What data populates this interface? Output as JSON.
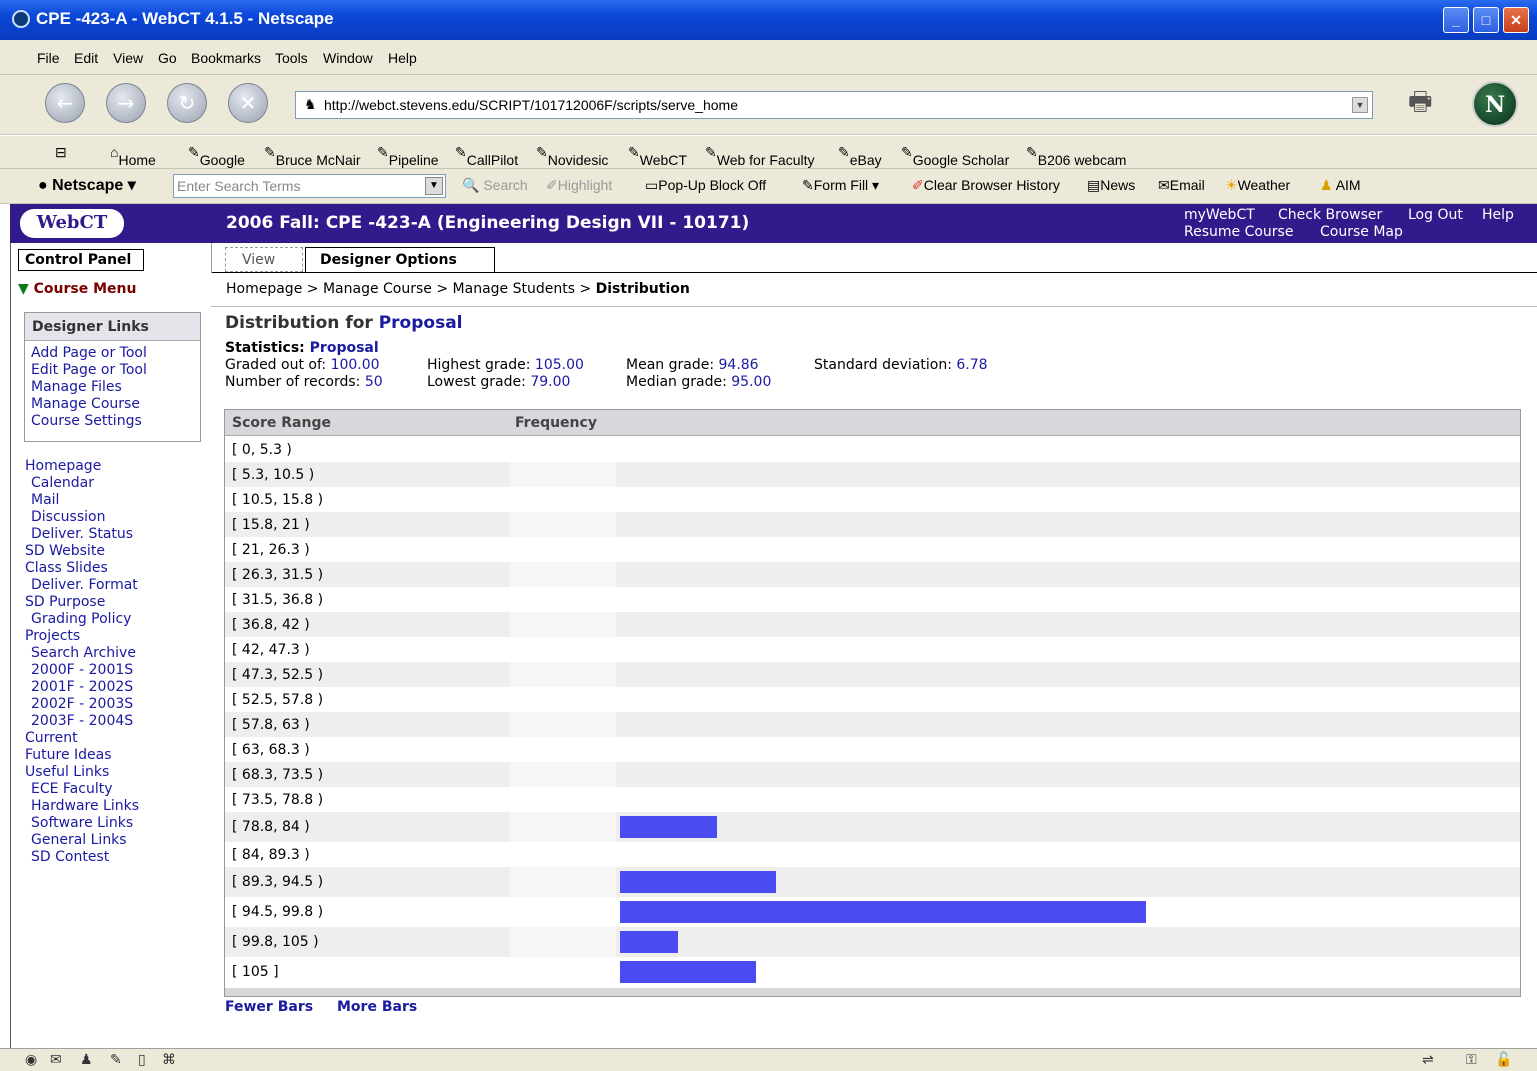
{
  "window": {
    "title": "CPE -423-A - WebCT 4.1.5 - Netscape"
  },
  "menu": [
    "File",
    "Edit",
    "View",
    "Go",
    "Bookmarks",
    "Tools",
    "Window",
    "Help"
  ],
  "address": {
    "url": "http://webct.stevens.edu/SCRIPT/101712006F/scripts/serve_home"
  },
  "bookmarks": [
    "Home",
    "Google",
    "Bruce McNair",
    "Pipeline",
    "CallPilot",
    "Novidesic",
    "WebCT",
    "Web for Faculty",
    "eBay",
    "Google Scholar",
    "B206 webcam"
  ],
  "toolbar": {
    "brand": "Netscape ▾",
    "search_placeholder": "Enter Search Terms",
    "search": "Search",
    "highlight": "Highlight",
    "popup": "Pop-Up Block Off",
    "formfill": "Form Fill ▾",
    "clear_history": "Clear Browser History",
    "news": "News",
    "email": "Email",
    "weather": "Weather",
    "aim": "AIM"
  },
  "webct": {
    "logo": "WebCT",
    "course_title": "2006 Fall: CPE -423-A  (Engineering Design VII - 10171)",
    "links": {
      "my_webct": "myWebCT",
      "check_browser": "Check Browser",
      "log_out": "Log Out",
      "help": "Help",
      "resume_course": "Resume Course",
      "course_map": "Course Map"
    }
  },
  "left": {
    "control_panel": "Control Panel",
    "course_menu": "Course Menu",
    "designer_links_title": "Designer Links",
    "designer_links": [
      "Add Page or Tool",
      "Edit Page or Tool",
      "Manage Files",
      "Manage Course",
      "Course Settings"
    ],
    "course_nav": [
      {
        "label": "Homepage",
        "indent": false
      },
      {
        "label": "Calendar",
        "indent": true
      },
      {
        "label": "Mail",
        "indent": true
      },
      {
        "label": "Discussion",
        "indent": true
      },
      {
        "label": "Deliver. Status",
        "indent": true
      },
      {
        "label": "SD Website",
        "indent": false
      },
      {
        "label": "Class Slides",
        "indent": false
      },
      {
        "label": "Deliver. Format",
        "indent": true
      },
      {
        "label": "SD Purpose",
        "indent": false
      },
      {
        "label": "Grading Policy",
        "indent": true
      },
      {
        "label": "Projects",
        "indent": false
      },
      {
        "label": "Search Archive",
        "indent": true
      },
      {
        "label": "2000F - 2001S",
        "indent": true
      },
      {
        "label": "2001F - 2002S",
        "indent": true
      },
      {
        "label": "2002F - 2003S",
        "indent": true
      },
      {
        "label": "2003F - 2004S",
        "indent": true
      },
      {
        "label": "Current",
        "indent": false
      },
      {
        "label": "Future Ideas",
        "indent": false
      },
      {
        "label": "Useful Links",
        "indent": false
      },
      {
        "label": "ECE Faculty",
        "indent": true
      },
      {
        "label": "Hardware Links",
        "indent": true
      },
      {
        "label": "Software Links",
        "indent": true
      },
      {
        "label": "General Links",
        "indent": true
      },
      {
        "label": "SD Contest",
        "indent": true
      }
    ]
  },
  "tabs": {
    "view": "View",
    "designer_options": "Designer Options"
  },
  "breadcrumb": {
    "items": [
      "Homepage",
      "Manage Course",
      "Manage Students"
    ],
    "current": "Distribution",
    "sep": ">"
  },
  "distribution": {
    "title_prefix": "Distribution for",
    "title_name": "Proposal",
    "stats_label": "Statistics:",
    "stats_name": "Proposal",
    "graded_out_of_label": "Graded out of:",
    "graded_out_of": "100.00",
    "num_records_label": "Number of records:",
    "num_records": "50",
    "highest_label": "Highest grade:",
    "highest": "105.00",
    "lowest_label": "Lowest grade:",
    "lowest": "79.00",
    "mean_label": "Mean grade:",
    "mean": "94.86",
    "median_label": "Median grade:",
    "median": "95.00",
    "std_label": "Standard deviation:",
    "std": "6.78",
    "col_score": "Score Range",
    "col_freq": "Frequency",
    "fewer_bars": "Fewer Bars",
    "more_bars": "More Bars",
    "bar_color": "#4b4bf2"
  },
  "chart_data": {
    "type": "bar",
    "orientation": "horizontal",
    "xlabel": "Frequency",
    "ylabel": "Score Range",
    "categories": [
      "[ 0, 5.3 )",
      "[ 5.3, 10.5 )",
      "[ 10.5, 15.8 )",
      "[ 15.8, 21 )",
      "[ 21, 26.3 )",
      "[ 26.3, 31.5 )",
      "[ 31.5, 36.8 )",
      "[ 36.8, 42 )",
      "[ 42, 47.3 )",
      "[ 47.3, 52.5 )",
      "[ 52.5, 57.8 )",
      "[ 57.8, 63 )",
      "[ 63, 68.3 )",
      "[ 68.3, 73.5 )",
      "[ 73.5, 78.8 )",
      "[ 78.8, 84 )",
      "[ 84, 89.3 )",
      "[ 89.3, 94.5 )",
      "[ 94.5, 99.8 )",
      "[ 99.8, 105 )",
      "[ 105 ]"
    ],
    "values": [
      0,
      0,
      0,
      0,
      0,
      0,
      0,
      0,
      0,
      0,
      0,
      0,
      0,
      0,
      0,
      5,
      0,
      8,
      27,
      3,
      7
    ]
  }
}
